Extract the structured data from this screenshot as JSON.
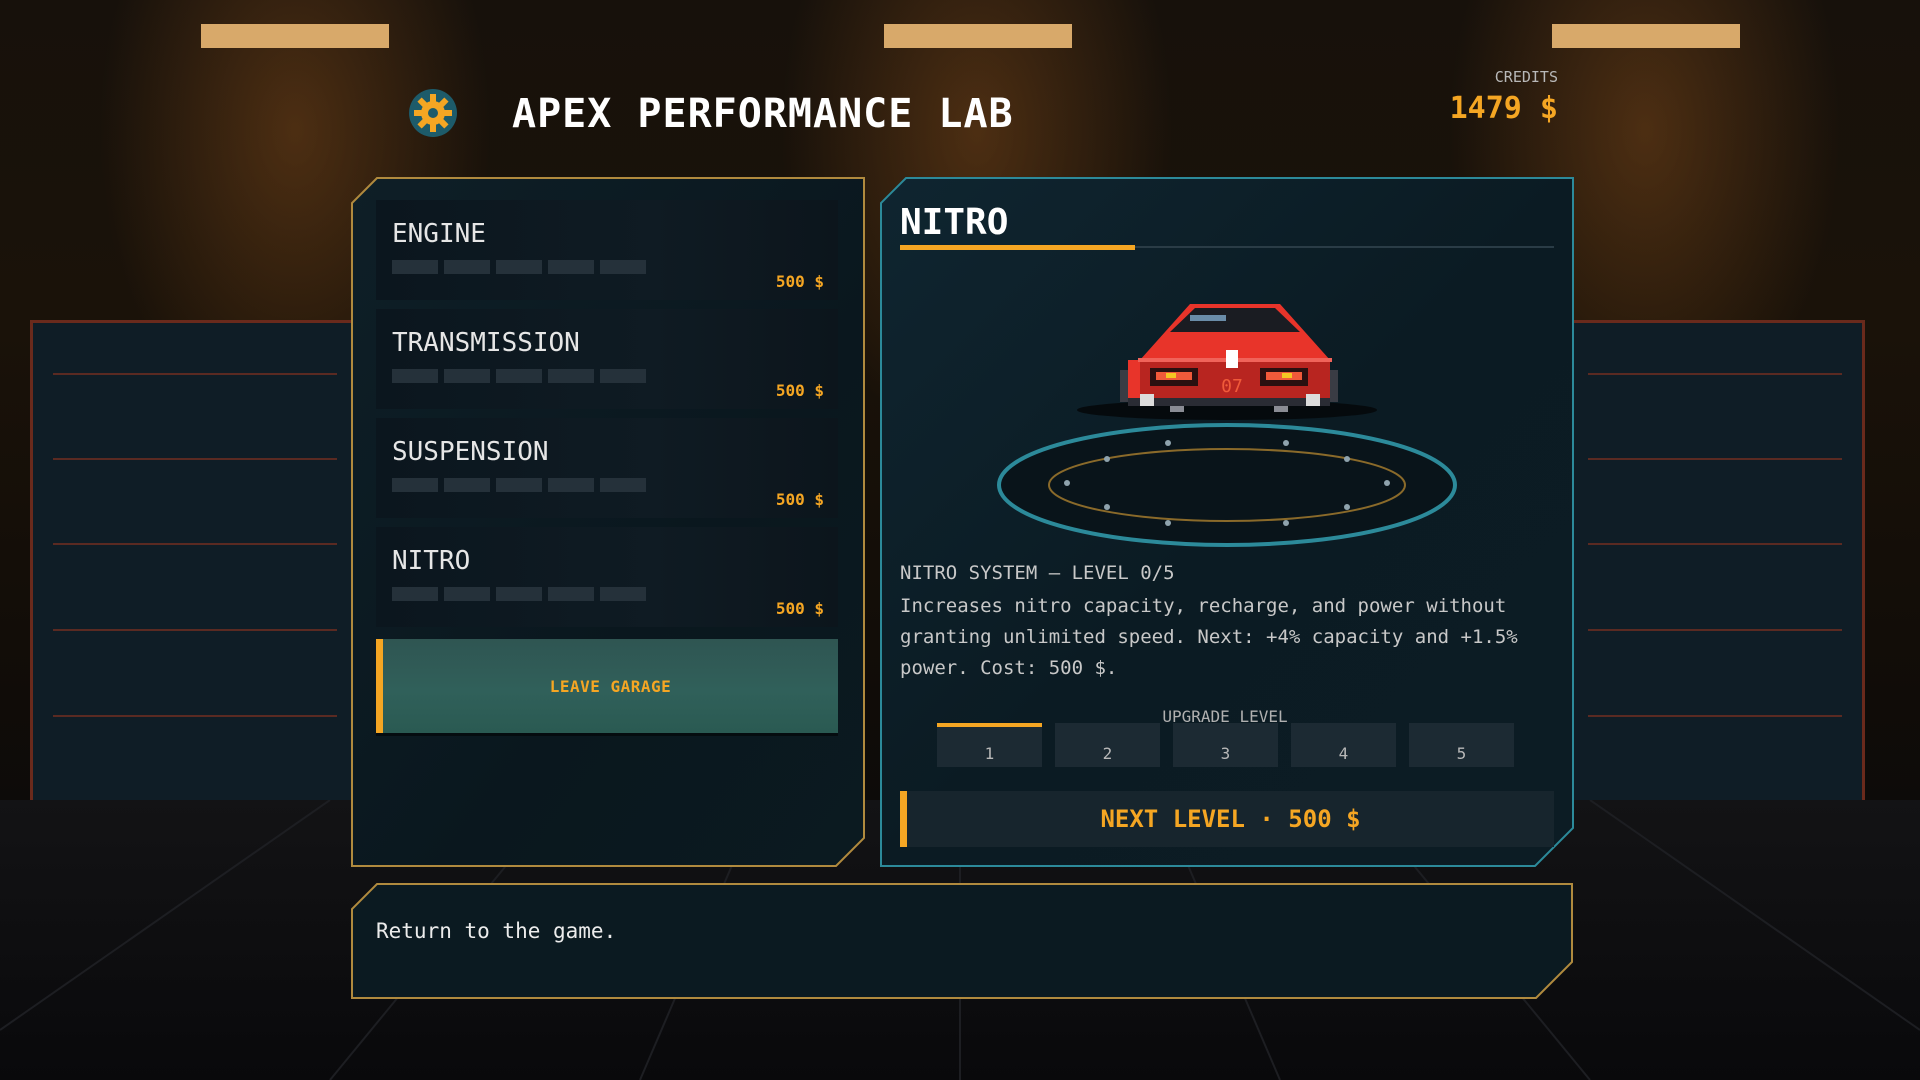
{
  "header": {
    "title": "APEX PERFORMANCE LAB",
    "icon": "gear-icon",
    "credits_label": "CREDITS",
    "credits_value": "1479 $"
  },
  "upgrades": [
    {
      "name": "ENGINE",
      "price": "500 $",
      "level": 0,
      "max_level": 5
    },
    {
      "name": "TRANSMISSION",
      "price": "500 $",
      "level": 0,
      "max_level": 5
    },
    {
      "name": "SUSPENSION",
      "price": "500 $",
      "level": 0,
      "max_level": 5
    },
    {
      "name": "NITRO",
      "price": "500 $",
      "level": 0,
      "max_level": 5
    }
  ],
  "leave_button": "LEAVE GARAGE",
  "detail": {
    "title": "NITRO",
    "car_plate": "07",
    "heading": "NITRO SYSTEM — LEVEL 0/5",
    "description": "Increases nitro capacity, recharge, and power without granting unlimited speed. Next: +4% capacity and +1.5% power. Cost: 500 $.",
    "upgrade_level_label": "UPGRADE LEVEL",
    "levels": [
      "1",
      "2",
      "3",
      "4",
      "5"
    ],
    "next_level_button": "NEXT LEVEL · 500 $"
  },
  "status_bar": {
    "message": "Return to the game."
  },
  "colors": {
    "accent": "#f5a623",
    "teal_border": "#2c8a9a",
    "gold_border": "#b08a3e",
    "car_red": "#e8342a"
  }
}
